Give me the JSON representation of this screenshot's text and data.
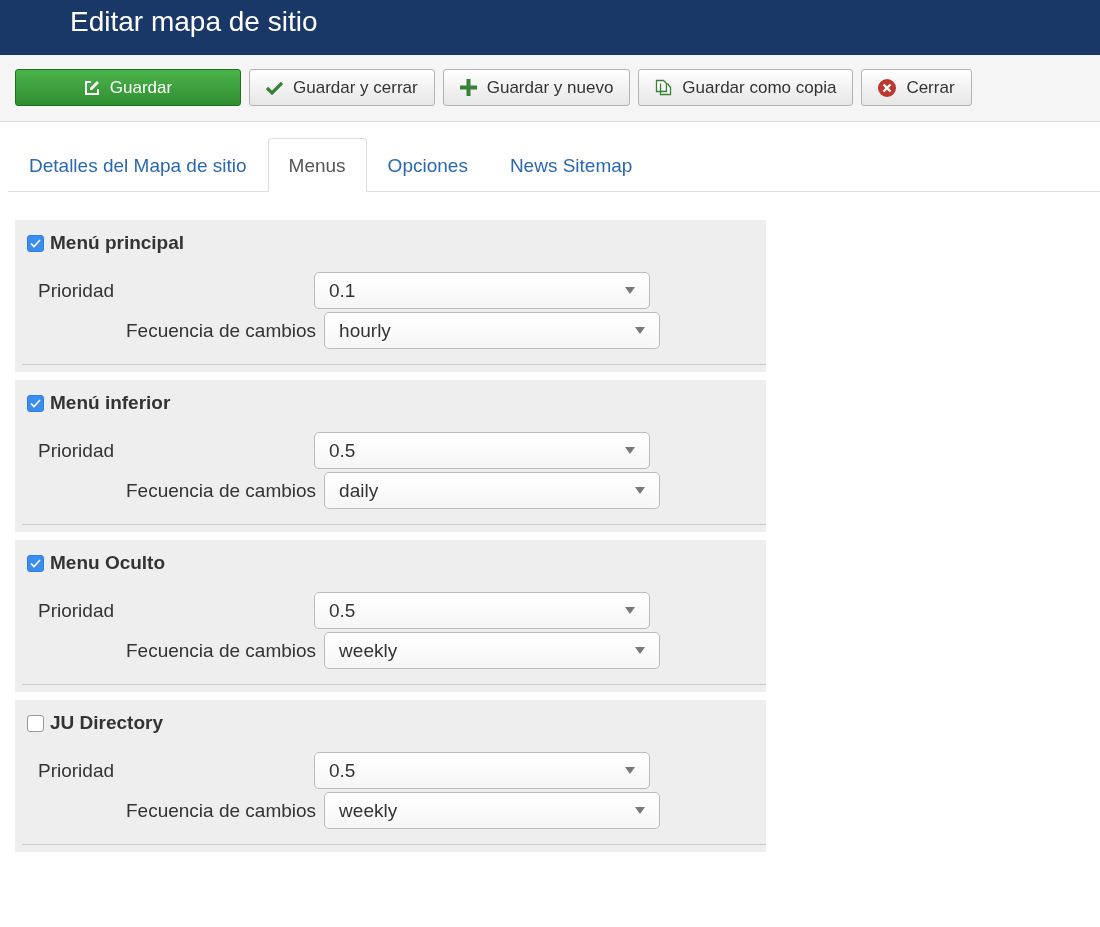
{
  "header": {
    "title": "Editar mapa de sitio"
  },
  "toolbar": [
    {
      "label": "Guardar",
      "kind": "edit"
    },
    {
      "label": "Guardar y cerrar",
      "kind": "check"
    },
    {
      "label": "Guardar y nuevo",
      "kind": "plus"
    },
    {
      "label": "Guardar como copia",
      "kind": "copy"
    },
    {
      "label": "Cerrar",
      "kind": "close"
    }
  ],
  "tabs": [
    {
      "label": "Detalles del Mapa de sitio",
      "selected": false
    },
    {
      "label": "Menus",
      "selected": true
    },
    {
      "label": "Opciones",
      "selected": false
    },
    {
      "label": "News Sitemap",
      "selected": false
    }
  ],
  "menus": [
    {
      "title": "Menú principal",
      "checked": true,
      "priority_label": "Prioridad",
      "priority": "0.1",
      "frequency_label": "Fecuencia de cambios",
      "frequency": "hourly"
    },
    {
      "title": "Menú inferior",
      "checked": true,
      "priority_label": "Prioridad",
      "priority": "0.5",
      "frequency_label": "Fecuencia de cambios",
      "frequency": "daily"
    },
    {
      "title": "Menu Oculto",
      "checked": true,
      "priority_label": "Prioridad",
      "priority": "0.5",
      "frequency_label": "Fecuencia de cambios",
      "frequency": "weekly"
    },
    {
      "title": "JU Directory",
      "checked": false,
      "priority_label": "Prioridad",
      "priority": "0.5",
      "frequency_label": "Fecuencia de cambios",
      "frequency": "weekly"
    }
  ]
}
